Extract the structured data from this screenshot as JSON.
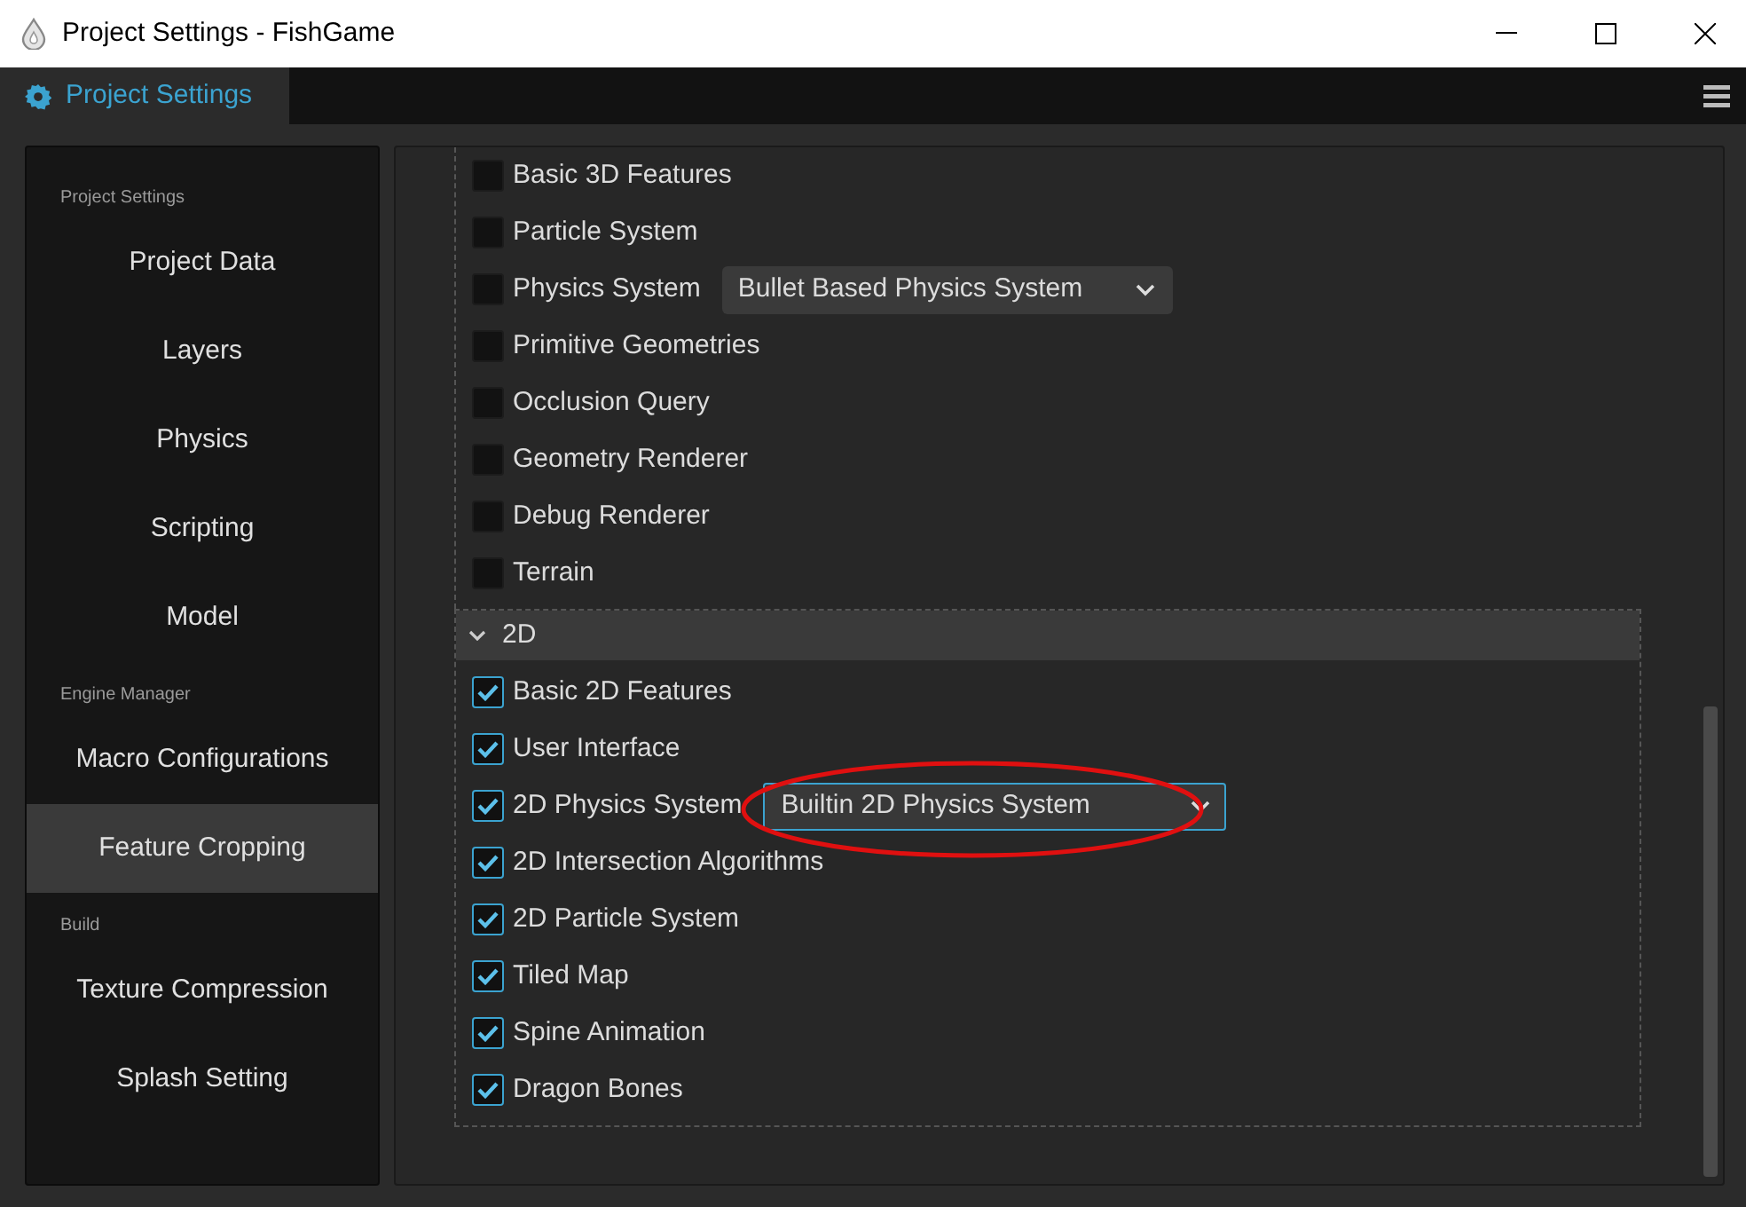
{
  "window": {
    "title": "Project Settings - FishGame"
  },
  "tabs": [
    {
      "label": "Project Settings",
      "selected": true
    }
  ],
  "sidebar": {
    "groups": [
      {
        "header": "Project Settings",
        "items": [
          {
            "label": "Project Data",
            "selected": false
          },
          {
            "label": "Layers",
            "selected": false
          },
          {
            "label": "Physics",
            "selected": false
          },
          {
            "label": "Scripting",
            "selected": false
          },
          {
            "label": "Model",
            "selected": false
          }
        ]
      },
      {
        "header": "Engine Manager",
        "items": [
          {
            "label": "Macro Configurations",
            "selected": false
          },
          {
            "label": "Feature Cropping",
            "selected": true
          }
        ]
      },
      {
        "header": "Build",
        "items": [
          {
            "label": "Texture Compression",
            "selected": false
          },
          {
            "label": "Splash Setting",
            "selected": false
          }
        ]
      }
    ]
  },
  "features_3d": [
    {
      "label": "Basic 3D Features",
      "checked": false
    },
    {
      "label": "Particle System",
      "checked": false
    },
    {
      "label": "Physics System",
      "checked": false,
      "dropdown": {
        "value": "Bullet Based Physics System",
        "focused": false
      }
    },
    {
      "label": "Primitive Geometries",
      "checked": false
    },
    {
      "label": "Occlusion Query",
      "checked": false
    },
    {
      "label": "Geometry Renderer",
      "checked": false
    },
    {
      "label": "Debug Renderer",
      "checked": false
    },
    {
      "label": "Terrain",
      "checked": false
    }
  ],
  "section_2d": {
    "title": "2D",
    "expanded": true,
    "items": [
      {
        "label": "Basic 2D Features",
        "checked": true
      },
      {
        "label": "User Interface",
        "checked": true
      },
      {
        "label": "2D Physics System",
        "checked": true,
        "dropdown": {
          "value": "Builtin 2D Physics System",
          "focused": true,
          "circled": true
        }
      },
      {
        "label": "2D Intersection Algorithms",
        "checked": true
      },
      {
        "label": "2D Particle System",
        "checked": true
      },
      {
        "label": "Tiled Map",
        "checked": true
      },
      {
        "label": "Spine Animation",
        "checked": true
      },
      {
        "label": "Dragon Bones",
        "checked": true
      }
    ]
  }
}
